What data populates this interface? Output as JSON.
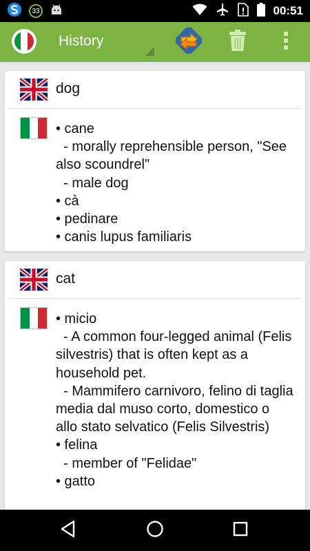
{
  "status_bar": {
    "notification_count": "33",
    "time": "00:51",
    "icons": [
      "app-s-icon",
      "notification-count-badge",
      "android-icon",
      "wifi-icon",
      "airplane-mode-icon",
      "no-sim-icon",
      "battery-icon"
    ]
  },
  "app_bar": {
    "title": "History",
    "source_language_flag": "italy-flag-icon",
    "actions": [
      "swap-languages-icon",
      "trash-icon",
      "overflow-menu-icon"
    ]
  },
  "colors": {
    "app_bar": "#7cb342",
    "status_bar": "#000000",
    "background": "#e8e8e8",
    "card": "#ffffff",
    "italy_green": "#009246",
    "italy_white": "#ffffff",
    "italy_red": "#ce2b37",
    "uk_blue": "#012169",
    "uk_red": "#c8102e"
  },
  "history": [
    {
      "word": "dog",
      "word_flag": "uk-flag-icon",
      "translation_flag": "italy-flag-icon",
      "lines": [
        "• cane",
        "  - morally reprehensible person, \"See also scoundrel\"",
        "  - male dog",
        "• cà",
        "• pedinare",
        "• canis lupus familiaris"
      ]
    },
    {
      "word": "cat",
      "word_flag": "uk-flag-icon",
      "translation_flag": "italy-flag-icon",
      "lines": [
        "• micio",
        "  - A common four-legged animal (Felis silvestris) that is often kept as a household pet.",
        "  - Mammifero carnivoro, felino di taglia media dal muso corto, domestico o allo stato selvatico (Felis Silvestris)",
        "• felina",
        "  - member of \"Felidae\"",
        "• gatto"
      ]
    }
  ],
  "nav_bar": {
    "icons": [
      "back-icon",
      "home-icon",
      "recent-apps-icon"
    ]
  }
}
